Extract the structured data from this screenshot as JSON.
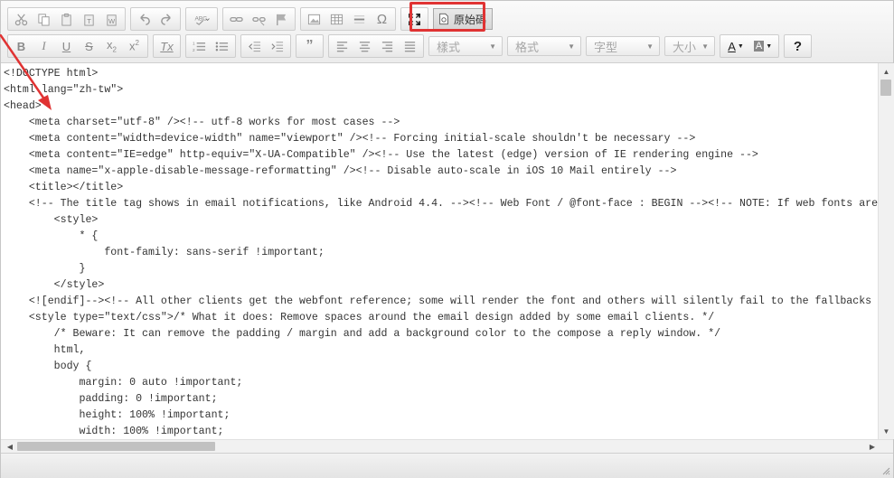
{
  "toolbar": {
    "source_label": "原始碼",
    "help_label": "?",
    "style_combo": "樣式",
    "format_combo": "格式",
    "font_combo": "字型",
    "size_combo": "大小",
    "text_color_label": "A",
    "bg_color_label": "A"
  },
  "editor": {
    "lines": [
      "<!DOCTYPE html>",
      "<html lang=\"zh-tw\">",
      "<head>",
      "    <meta charset=\"utf-8\" /><!-- utf-8 works for most cases -->",
      "    <meta content=\"width=device-width\" name=\"viewport\" /><!-- Forcing initial-scale shouldn't be necessary -->",
      "    <meta content=\"IE=edge\" http-equiv=\"X-UA-Compatible\" /><!-- Use the latest (edge) version of IE rendering engine -->",
      "    <meta name=\"x-apple-disable-message-reformatting\" /><!-- Disable auto-scale in iOS 10 Mail entirely -->",
      "    <title></title>",
      "    <!-- The title tag shows in email notifications, like Android 4.4. --><!-- Web Font / @font-face : BEGIN --><!-- NOTE: If web fonts are",
      "        <style>",
      "            * {",
      "                font-family: sans-serif !important;",
      "            }",
      "        </style>",
      "    <![endif]--><!-- All other clients get the webfont reference; some will render the font and others will silently fail to the fallbacks",
      "    <style type=\"text/css\">/* What it does: Remove spaces around the email design added by some email clients. */",
      "        /* Beware: It can remove the padding / margin and add a background color to the compose a reply window. */",
      "        html,",
      "        body {",
      "            margin: 0 auto !important;",
      "            padding: 0 !important;",
      "            height: 100% !important;",
      "            width: 100% !important;"
    ]
  },
  "colors": {
    "highlight": "#e03333",
    "toolbar_bg": "#ececec",
    "border": "#c6c6c6"
  }
}
